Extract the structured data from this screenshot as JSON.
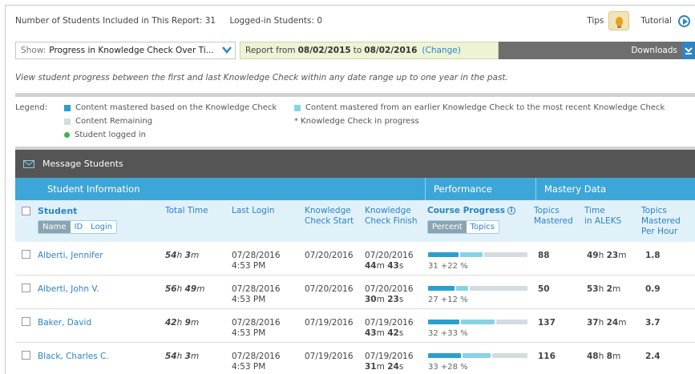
{
  "top": {
    "students_included": "Number of Students Included in This Report: 31",
    "logged_in": "Logged-in Students: 0",
    "tips": "Tips",
    "tutorial": "Tutorial"
  },
  "filter": {
    "show_label": "Show:",
    "show_value": "Progress in Knowledge Check Over Ti...",
    "report_prefix": "Report from",
    "date_from": "08/02/2016",
    "date_from_actual": "08/02/2015",
    "to": "to",
    "date_to": "08/02/2016",
    "change": "(Change)",
    "downloads": "Downloads"
  },
  "description": "View student progress between the first and last Knowledge Check within any date range up to one year in the past.",
  "legend": {
    "title": "Legend:",
    "items": [
      "Content mastered based on the Knowledge Check",
      "Content mastered from an earlier Knowledge Check to the most recent Knowledge Check",
      "Content Remaining",
      "* Knowledge Check in progress",
      "Student logged in"
    ]
  },
  "message_students": "Message Students",
  "groups": {
    "student_info": "Student Information",
    "performance": "Performance",
    "mastery": "Mastery Data"
  },
  "columns": {
    "student": "Student",
    "name": "Name",
    "id": "ID",
    "login": "Login",
    "total_time": "Total Time",
    "last_login": "Last Login",
    "kc_start_1": "Knowledge",
    "kc_start_2": "Check Start",
    "kc_finish_1": "Knowledge",
    "kc_finish_2": "Check Finish",
    "course_progress": "Course Progress",
    "percent": "Percent",
    "topics": "Topics",
    "topics_mastered_1": "Topics",
    "topics_mastered_2": "Mastered",
    "time_aleks_1": "Time",
    "time_aleks_2": "in ALEKS",
    "tmph_1": "Topics",
    "tmph_2": "Mastered",
    "tmph_3": "Per Hour"
  },
  "colors": {
    "dark_blue": "#2a9fd1",
    "light_blue": "#86d3e6",
    "remaining": "#d4dcdf"
  },
  "rows": [
    {
      "name": "Alberti, Jennifer",
      "th": "54",
      "tm": "3",
      "login_date": "07/28/2016",
      "login_time": "4:53 PM",
      "start": "07/20/2016",
      "finish": "07/20/2016",
      "fm": "44",
      "fs": "43",
      "progress": "31 +22 %",
      "base": 31,
      "gain": 22,
      "mastered": "88",
      "ah": "49",
      "am": "23",
      "per_hour": "1.8"
    },
    {
      "name": "Alberti, John V.",
      "th": "56",
      "tm": "49",
      "login_date": "07/28/2016",
      "login_time": "4:53 PM",
      "start": "07/20/2016",
      "finish": "07/20/2016",
      "fm": "30",
      "fs": "23",
      "progress": "27 +12 %",
      "base": 27,
      "gain": 12,
      "mastered": "50",
      "ah": "53",
      "am": "2",
      "per_hour": "0.9"
    },
    {
      "name": "Baker, David",
      "th": "42",
      "tm": "9",
      "login_date": "07/28/2016",
      "login_time": "4:53 PM",
      "start": "07/19/2016",
      "finish": "07/19/2016",
      "fm": "43",
      "fs": "42",
      "progress": "32 +33 %",
      "base": 32,
      "gain": 33,
      "mastered": "137",
      "ah": "37",
      "am": "24",
      "per_hour": "3.7"
    },
    {
      "name": "Black, Charles C.",
      "th": "54",
      "tm": "3",
      "login_date": "07/28/2016",
      "login_time": "4:53 PM",
      "start": "07/19/2016",
      "finish": "07/19/2016",
      "fm": "31",
      "fs": "24",
      "progress": "33 +28 %",
      "base": 33,
      "gain": 28,
      "mastered": "116",
      "ah": "48",
      "am": "8",
      "per_hour": "2.4"
    }
  ]
}
